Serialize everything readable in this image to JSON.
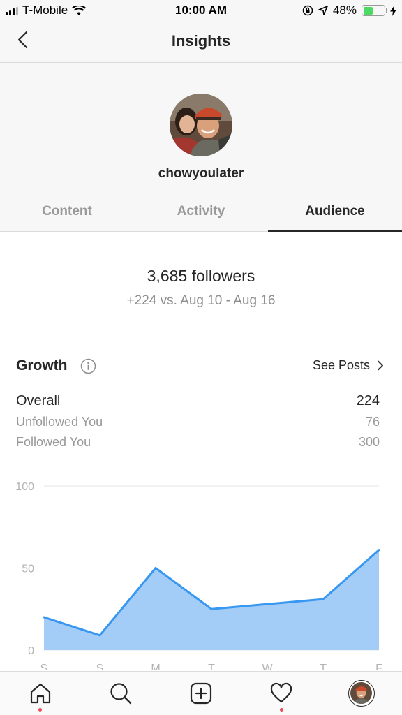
{
  "status_bar": {
    "carrier": "T-Mobile",
    "time": "10:00 AM",
    "battery_percent": "48%",
    "battery_level": 0.48,
    "icons": [
      "signal-icon",
      "wifi-icon",
      "orientation-lock-icon",
      "location-arrow-icon",
      "battery-icon",
      "charging-bolt-icon"
    ]
  },
  "header": {
    "title": "Insights",
    "back_icon": "chevron-left-icon"
  },
  "profile": {
    "username": "chowyoulater"
  },
  "tabs": [
    {
      "label": "Content",
      "active": false
    },
    {
      "label": "Activity",
      "active": false
    },
    {
      "label": "Audience",
      "active": true
    }
  ],
  "summary": {
    "followers": "3,685 followers",
    "delta": "+224 vs. Aug 10 - Aug 16"
  },
  "growth": {
    "title": "Growth",
    "info_icon": "info-icon",
    "see_posts_label": "See Posts",
    "overall_label": "Overall",
    "overall_value": "224",
    "unfollowed_label": "Unfollowed You",
    "unfollowed_value": "76",
    "followed_label": "Followed You",
    "followed_value": "300"
  },
  "chart_data": {
    "type": "area",
    "categories": [
      "S",
      "S",
      "M",
      "T",
      "W",
      "T",
      "F"
    ],
    "values": [
      20,
      9,
      50,
      25,
      28,
      31,
      61
    ],
    "yticks": [
      0,
      50,
      100
    ],
    "ylim": [
      0,
      100
    ],
    "grid": true,
    "colors": {
      "fill": "#a3cdf7",
      "line": "#3897f0"
    }
  },
  "bottom_nav": [
    {
      "icon": "home-icon",
      "dot": true
    },
    {
      "icon": "search-icon",
      "dot": false
    },
    {
      "icon": "add-post-icon",
      "dot": false
    },
    {
      "icon": "heart-icon",
      "dot": true
    },
    {
      "icon": "profile-avatar-icon",
      "dot": false
    }
  ],
  "colors": {
    "accent": "#3897f0",
    "notification": "#ed4956",
    "muted_text": "#999999"
  }
}
